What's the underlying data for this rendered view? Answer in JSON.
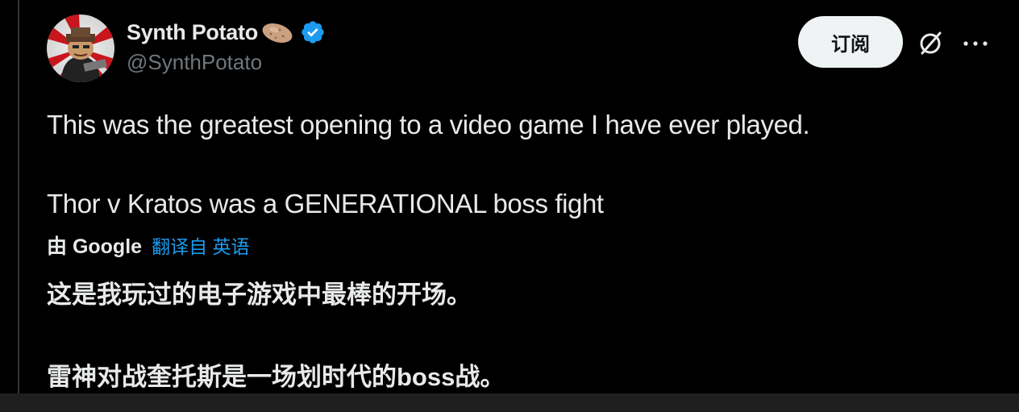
{
  "author": {
    "display_name": "Synth Potato",
    "handle": "@SynthPotato",
    "avatar_icon": "avatar-image",
    "emoji_icon": "potato-icon",
    "verified_icon": "verified-badge-icon"
  },
  "header": {
    "subscribe_label": "订阅",
    "grok_icon": "grok-icon",
    "more_icon": "more-icon"
  },
  "tweet": {
    "line_1": "This was the greatest opening to a video game I have ever played.",
    "line_2": "Thor v Kratos was a GENERATIONAL boss fight"
  },
  "translation": {
    "by_label": "由 Google",
    "link_label": "翻译自 英语",
    "line_1": "这是我玩过的电子游戏中最棒的开场。",
    "line_2": "雷神对战奎托斯是一场划时代的boss战。"
  },
  "colors": {
    "background": "#000000",
    "text": "#e7e9ea",
    "secondary": "#71767b",
    "link": "#1d9bf0",
    "verified": "#1d9bf0",
    "button_bg": "#eff3f4"
  }
}
